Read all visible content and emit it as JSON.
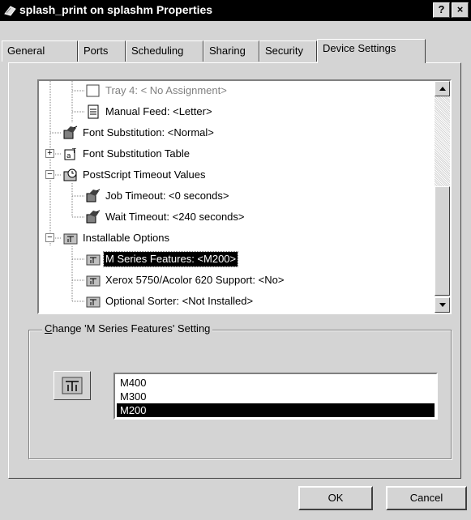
{
  "window": {
    "title": "splash_print on splashm Properties",
    "help_label": "?",
    "close_label": "×"
  },
  "tabs": [
    {
      "label": "General",
      "active": false
    },
    {
      "label": "Ports",
      "active": false
    },
    {
      "label": "Scheduling",
      "active": false
    },
    {
      "label": "Sharing",
      "active": false
    },
    {
      "label": "Security",
      "active": false
    },
    {
      "label": "Device Settings",
      "active": true
    }
  ],
  "tree": {
    "items": [
      {
        "label": "Tray 4: < No Assignment>",
        "icon": "tray-icon",
        "disabled": true
      },
      {
        "label": "Manual Feed: <Letter>",
        "icon": "document-icon"
      },
      {
        "label": "Font Substitution: <Normal>",
        "icon": "settings-icon"
      },
      {
        "label": "Font Substitution Table",
        "icon": "font-table-icon",
        "expander": "+"
      },
      {
        "label": "PostScript Timeout Values",
        "icon": "timeout-folder-icon",
        "expander": "−"
      },
      {
        "label": "Job Timeout: <0 seconds>",
        "icon": "settings-icon"
      },
      {
        "label": "Wait Timeout: <240 seconds>",
        "icon": "settings-icon"
      },
      {
        "label": "Installable Options",
        "icon": "options-icon",
        "expander": "−"
      },
      {
        "label": "M Series Features: <M200>",
        "icon": "options-icon",
        "selected": true
      },
      {
        "label": "Xerox 5750/Acolor 620 Support: <No>",
        "icon": "options-icon"
      },
      {
        "label": "Optional Sorter: <Not Installed>",
        "icon": "options-icon"
      }
    ]
  },
  "setting_group": {
    "legend_accel": "C",
    "legend_rest": "hange 'M Series Features' Setting",
    "options": [
      {
        "label": "M400",
        "selected": false
      },
      {
        "label": "M300",
        "selected": false
      },
      {
        "label": "M200",
        "selected": true
      }
    ]
  },
  "buttons": {
    "ok": "OK",
    "cancel": "Cancel"
  }
}
